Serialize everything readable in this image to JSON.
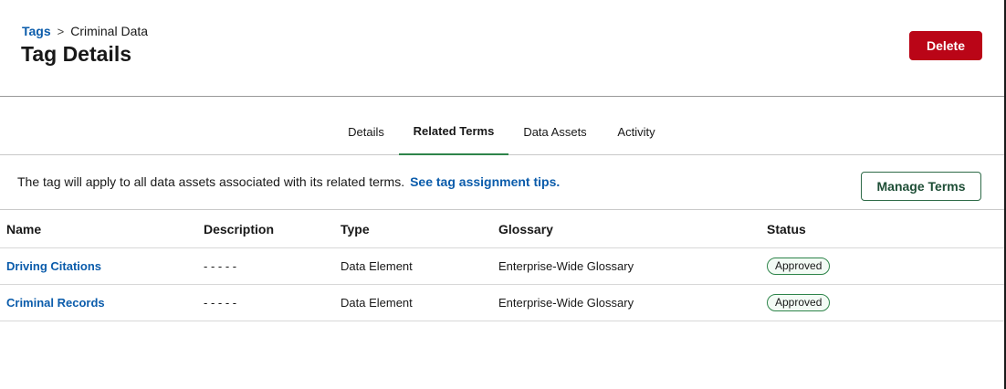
{
  "header": {
    "breadcrumb": {
      "parent": "Tags",
      "separator": ">",
      "current": "Criminal Data"
    },
    "title": "Tag Details",
    "delete_label": "Delete"
  },
  "tabs": [
    {
      "label": "Details",
      "active": false
    },
    {
      "label": "Related Terms",
      "active": true
    },
    {
      "label": "Data Assets",
      "active": false
    },
    {
      "label": "Activity",
      "active": false
    }
  ],
  "info": {
    "text": "The tag will apply to all data assets associated with its related terms.",
    "link": "See tag assignment tips.",
    "manage_label": "Manage Terms"
  },
  "table": {
    "columns": [
      "Name",
      "Description",
      "Type",
      "Glossary",
      "Status"
    ],
    "rows": [
      {
        "name": "Driving Citations",
        "description": "- - - - -",
        "type": "Data Element",
        "glossary": "Enterprise-Wide Glossary",
        "status": "Approved"
      },
      {
        "name": "Criminal Records",
        "description": "- - - - -",
        "type": "Data Element",
        "glossary": "Enterprise-Wide Glossary",
        "status": "Approved"
      }
    ]
  },
  "colors": {
    "brand_link": "#0b5cab",
    "destructive": "#ba0517",
    "success": "#2e844a"
  }
}
